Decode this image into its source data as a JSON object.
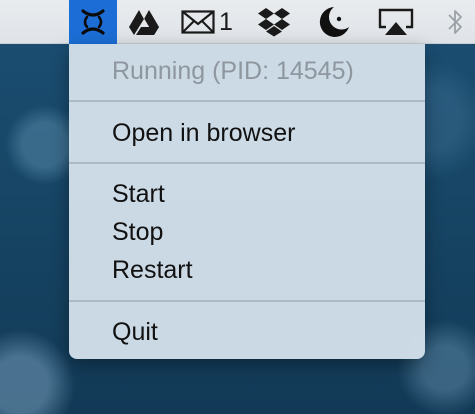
{
  "menubar": {
    "mail_count": "1"
  },
  "menu": {
    "status": "Running (PID: 14545)",
    "open_browser": "Open in browser",
    "start": "Start",
    "stop": "Stop",
    "restart": "Restart",
    "quit": "Quit"
  },
  "icons": {
    "app": "app-status-icon",
    "drive": "google-drive-icon",
    "mail": "envelope-icon",
    "dropbox": "dropbox-icon",
    "moon": "night-shift-moon-icon",
    "airplay": "airplay-icon",
    "bluetooth": "bluetooth-icon"
  },
  "colors": {
    "highlight": "#1c6ed6",
    "menubar_bg": "#e4e7ea",
    "menu_bg": "#d3e0ea",
    "disabled_text": "#8e979f"
  }
}
